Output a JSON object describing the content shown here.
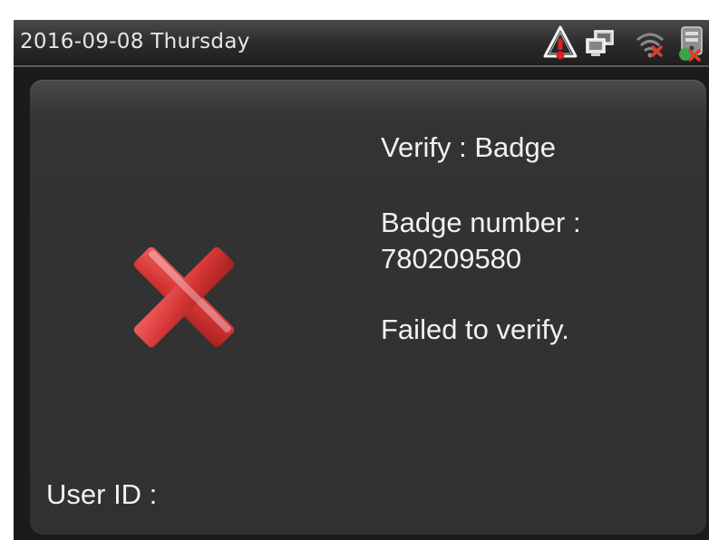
{
  "status_bar": {
    "datetime": "2016-09-08  Thursday",
    "icons": [
      "alarm-warning-icon",
      "network-computer-icon",
      "wifi-disconnected-icon",
      "server-disconnected-icon"
    ]
  },
  "verification": {
    "verify_line": "Verify : Badge",
    "badge_label": "Badge number :",
    "badge_number": "780209580",
    "result_message": "Failed to verify.",
    "result_icon": "failed-x-icon",
    "user_id_label": "User ID :"
  },
  "colors": {
    "background": "#313131",
    "text": "#f1f1f1",
    "fail_red": "#d83838",
    "warning_red": "#e02020"
  }
}
